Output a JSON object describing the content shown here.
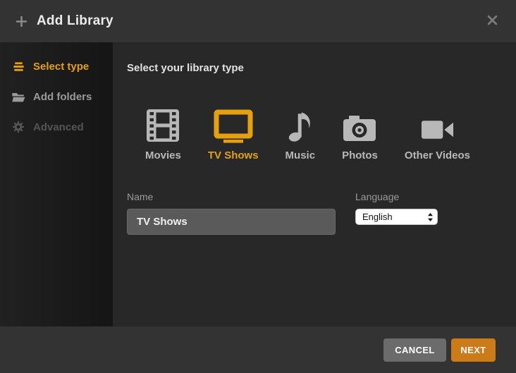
{
  "window": {
    "title": "Add Library"
  },
  "colors": {
    "accent_gold": "#e5a00d",
    "accent_orange": "#cc7b19",
    "header_bg": "#333333",
    "sidebar_bg": "#1a1a1a",
    "content_bg": "#282828",
    "input_bg": "#5a5a5a",
    "cancel_button_bg": "#6b6b6b",
    "select_bg": "#ffffff"
  },
  "header": {
    "title": "Add Library",
    "plus_icon": "plus-icon",
    "close_icon": "close-icon"
  },
  "sidebar": {
    "items": [
      {
        "label": "Select type",
        "icon": "list-lines-icon",
        "state": "active"
      },
      {
        "label": "Add folders",
        "icon": "folder-icon",
        "state": "default"
      },
      {
        "label": "Advanced",
        "icon": "gear-icon",
        "state": "disabled"
      }
    ]
  },
  "content": {
    "heading": "Select your library type",
    "library_types": [
      {
        "label": "Movies",
        "icon": "film-strip-icon",
        "selected": false
      },
      {
        "label": "TV Shows",
        "icon": "tv-icon",
        "selected": true
      },
      {
        "label": "Music",
        "icon": "music-note-icon",
        "selected": false
      },
      {
        "label": "Photos",
        "icon": "camera-icon",
        "selected": false
      },
      {
        "label": "Other Videos",
        "icon": "video-camera-icon",
        "selected": false
      }
    ],
    "name_field": {
      "label": "Name",
      "value": "TV Shows"
    },
    "language_field": {
      "label": "Language",
      "value": "English"
    }
  },
  "footer": {
    "cancel_label": "CANCEL",
    "next_label": "NEXT"
  }
}
